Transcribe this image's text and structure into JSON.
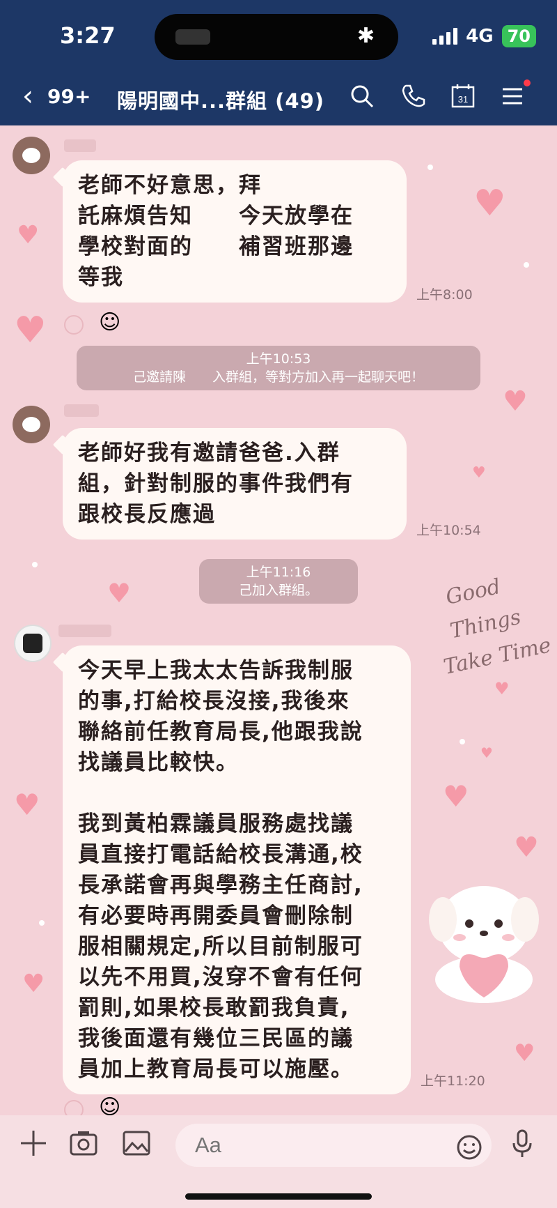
{
  "status_bar": {
    "time": "3:27",
    "network": "4G",
    "battery": "70"
  },
  "header": {
    "back_count": "99+",
    "title": "陽明國中...群組 (49)"
  },
  "messages": [
    {
      "text": "老師不好意思，拜\n託麻煩告知　　今天放學在\n學校對面的　　補習班那邊\n等我",
      "time": "上午8:00"
    },
    {
      "text": "老師好我有邀請爸爸.入群\n組，針對制服的事件我們有\n跟校長反應過",
      "time": "上午10:54"
    },
    {
      "text": "今天早上我太太告訴我制服\n的事,打給校長沒接,我後來\n聯絡前任教育局長,他跟我說\n找議員比較快。\n\n我到黃柏霖議員服務處找議\n員直接打電話給校長溝通,校\n長承諾會再與學務主任商討,\n有必要時再開委員會刪除制\n服相關規定,所以目前制服可\n以先不用買,沒穿不會有任何\n罰則,如果校長敢罰我負責,\n我後面還有幾位三民區的議\n員加上教育局長可以施壓。",
      "time": "上午11:20"
    }
  ],
  "system_notices": [
    {
      "time": "上午10:53",
      "text": "己邀請陳　　入群組，等對方加入再一起聊天吧！"
    },
    {
      "time": "上午11:16",
      "text": "己加入群組。"
    }
  ],
  "decoration": {
    "text_lines": [
      "Good",
      "Things",
      "Take Time"
    ]
  },
  "input": {
    "placeholder": "Aa"
  },
  "colors": {
    "header_bg": "#1d3766",
    "chat_bg": "#f4d2d8",
    "bubble_bg": "#fff8f4",
    "battery": "#38c35a"
  }
}
